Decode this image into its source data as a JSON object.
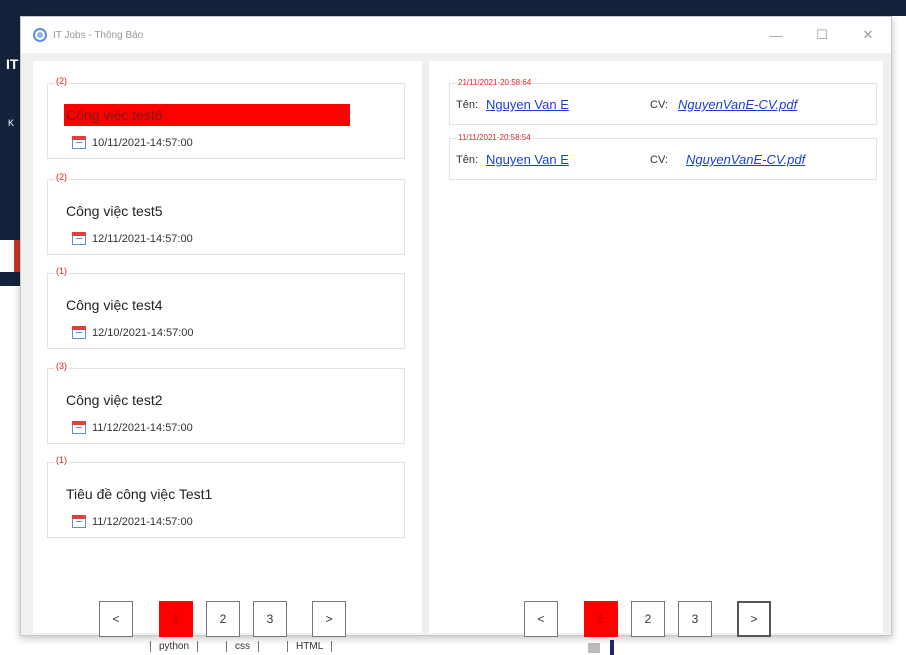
{
  "background": {
    "left_glyphs": [
      "IT",
      "K"
    ],
    "tags": [
      "python",
      "css",
      "HTML"
    ]
  },
  "window": {
    "title": "IT Jobs - Thông Báo",
    "controls": {
      "minimize": "—",
      "maximize": "☐",
      "close": "✕"
    }
  },
  "jobs": [
    {
      "count": "(2)",
      "title": "Công việc test6",
      "date": "10/11/2021-14:57:00",
      "selected": true
    },
    {
      "count": "(2)",
      "title": "Công việc test5",
      "date": "12/11/2021-14:57:00",
      "selected": false
    },
    {
      "count": "(1)",
      "title": "Công việc test4",
      "date": "12/10/2021-14:57:00",
      "selected": false
    },
    {
      "count": "(3)",
      "title": "Công việc test2",
      "date": "11/12/2021-14:57:00",
      "selected": false
    },
    {
      "count": "(1)",
      "title": "Tiêu đề công việc Test1",
      "date": "11/12/2021-14:57:00",
      "selected": false
    }
  ],
  "candidates": [
    {
      "time": "21/11/2021-20:58:64",
      "name_label": "Tên:",
      "name": "Nguyen Van E",
      "cv_label": "CV:",
      "cv_file": "NguyenVanE-CV.pdf"
    },
    {
      "time": "11/11/2021-20:58:54",
      "name_label": "Tên:",
      "name": "Nguyen Van E",
      "cv_label": "CV:",
      "cv_file": "NguyenVanE-CV.pdf"
    }
  ],
  "pager_left": {
    "prev": "<",
    "pages": [
      "1",
      "2",
      "3"
    ],
    "active": "1",
    "next": ">"
  },
  "pager_right": {
    "prev": "<",
    "pages": [
      "1",
      "2",
      "3"
    ],
    "active": "1",
    "next": ">"
  },
  "colors": {
    "accent": "#ff0000",
    "link": "#1a3fd6",
    "count": "#e02020"
  }
}
